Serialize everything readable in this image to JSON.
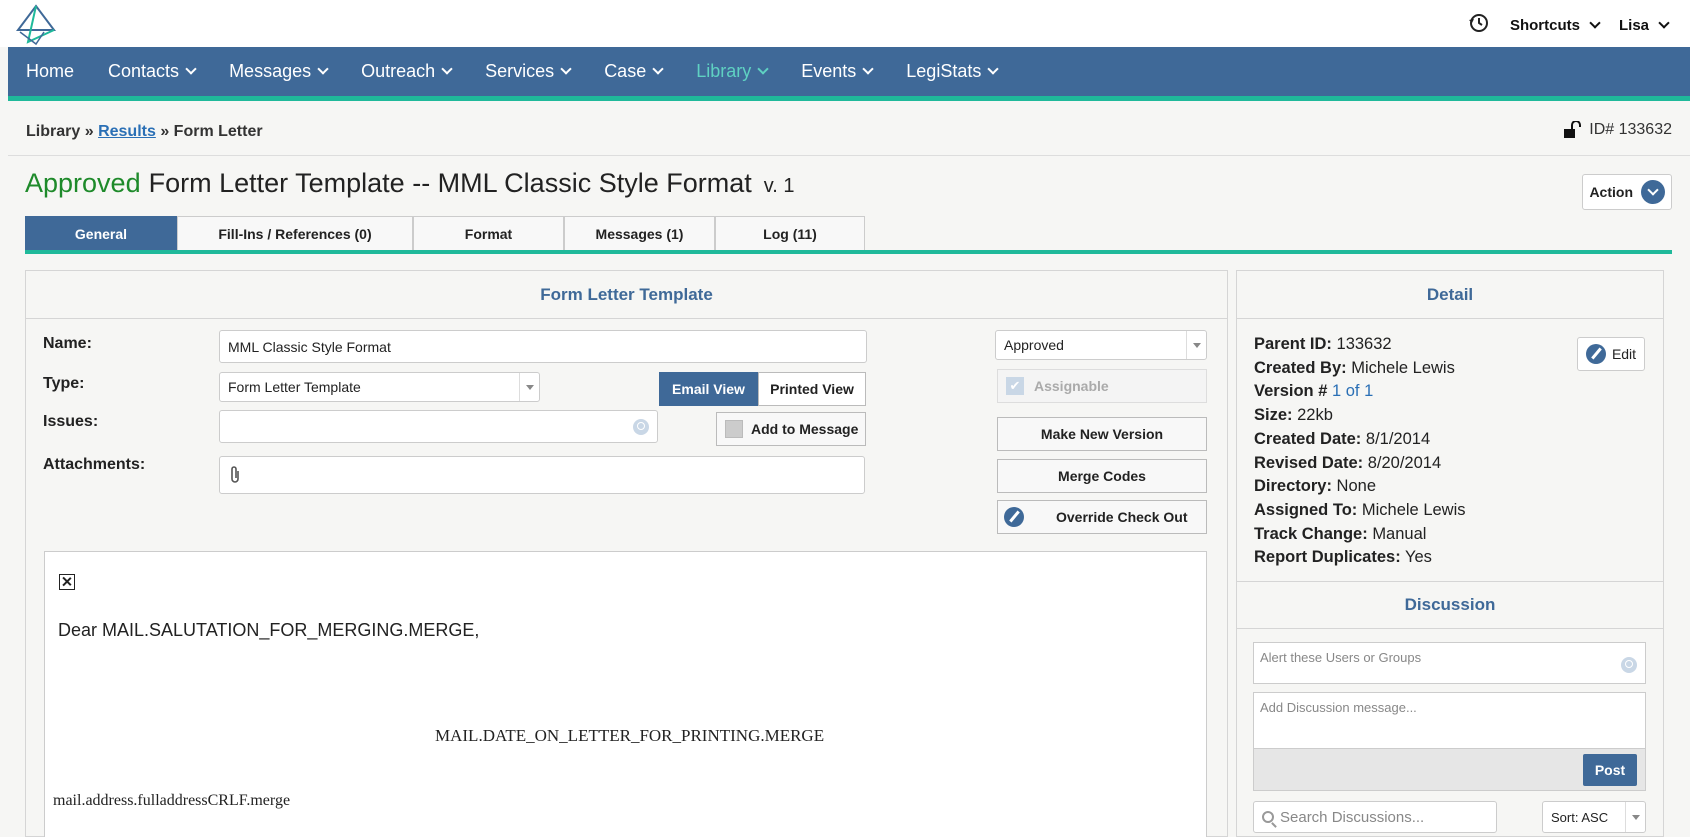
{
  "topbar": {
    "shortcuts_label": "Shortcuts",
    "user_label": "Lisa"
  },
  "nav": {
    "items": [
      {
        "label": "Home",
        "dropdown": false,
        "active": false
      },
      {
        "label": "Contacts",
        "dropdown": true,
        "active": false
      },
      {
        "label": "Messages",
        "dropdown": true,
        "active": false
      },
      {
        "label": "Outreach",
        "dropdown": true,
        "active": false
      },
      {
        "label": "Services",
        "dropdown": true,
        "active": false
      },
      {
        "label": "Case",
        "dropdown": true,
        "active": false
      },
      {
        "label": "Library",
        "dropdown": true,
        "active": true
      },
      {
        "label": "Events",
        "dropdown": true,
        "active": false
      },
      {
        "label": "LegiStats",
        "dropdown": true,
        "active": false
      }
    ]
  },
  "breadcrumb": {
    "root": "Library",
    "sep1": "»",
    "link": "Results",
    "sep2": "»",
    "current": "Form Letter"
  },
  "record": {
    "id_label": "ID# 133632"
  },
  "title": {
    "status": "Approved",
    "text": "Form Letter Template --  MML Classic Style Format",
    "version": "v. 1"
  },
  "action_label": "Action",
  "tabs": [
    {
      "label": "General",
      "active": true
    },
    {
      "label": "Fill-Ins / References (0)",
      "active": false
    },
    {
      "label": "Format",
      "active": false
    },
    {
      "label": "Messages (1)",
      "active": false
    },
    {
      "label": "Log (11)",
      "active": false
    }
  ],
  "form": {
    "heading": "Form Letter Template",
    "name_label": "Name:",
    "name_value": "MML Classic Style Format",
    "type_label": "Type:",
    "type_value": "Form Letter Template",
    "issues_label": "Issues:",
    "attachments_label": "Attachments:",
    "email_view": "Email View",
    "printed_view": "Printed View",
    "add_to_message": "Add to Message",
    "status_value": "Approved",
    "assignable": "Assignable",
    "make_new_version": "Make New Version",
    "merge_codes": "Merge Codes",
    "override_check_out": "Override Check Out"
  },
  "letter": {
    "salutation": "Dear MAIL.SALUTATION_FOR_MERGING.MERGE,",
    "date_field": "MAIL.DATE_ON_LETTER_FOR_PRINTING.MERGE",
    "address_field": "mail.address.fulladdressCRLF.merge"
  },
  "detail": {
    "heading": "Detail",
    "edit_label": "Edit",
    "parent_id_label": "Parent ID:",
    "parent_id": "133632",
    "created_by_label": "Created By:",
    "created_by": "Michele Lewis",
    "version_label": "Version #",
    "version": "1 of 1",
    "size_label": "Size:",
    "size": "22kb",
    "created_date_label": "Created Date:",
    "created_date": "8/1/2014",
    "revised_date_label": "Revised Date:",
    "revised_date": "8/20/2014",
    "directory_label": "Directory:",
    "directory": "None",
    "assigned_to_label": "Assigned To:",
    "assigned_to": "Michele Lewis",
    "track_change_label": "Track Change:",
    "track_change": "Manual",
    "report_duplicates_label": "Report Duplicates:",
    "report_duplicates": "Yes"
  },
  "discussion": {
    "heading": "Discussion",
    "alert_placeholder": "Alert these Users or Groups",
    "message_placeholder": "Add Discussion message...",
    "post_label": "Post",
    "search_placeholder": "Search Discussions...",
    "sort_value": "Sort: ASC"
  }
}
